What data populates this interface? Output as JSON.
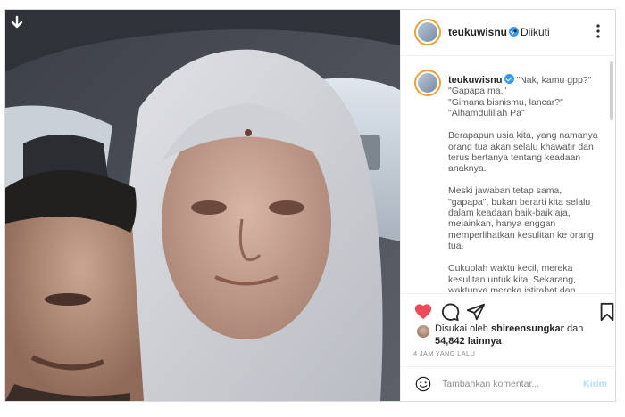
{
  "post": {
    "username": "teukuwisnu",
    "dot": "•",
    "follow_status": "Diikuti",
    "caption": {
      "lines": [
        "\"Nak, kamu gpp?\"",
        "\"Gapapa ma,\"",
        "\"Gimana bisnismu, lancar?\"",
        "\"Alhamdulillah Pa\""
      ],
      "paragraphs": [
        "Berapapun usia kita, yang namanya orang tua akan selalu khawatir dan terus bertanya tentang keadaan anaknya.",
        "Meski jawaban tetap sama, \"gapapa\", bukan berarti kita selalu dalam keadaan baik-baik aja, melainkan, hanya enggan memperlihatkan kesulitan ke orang tua.",
        "Cukuplah waktu kecil, mereka kesulitan untuk kita. Sekarang, waktunya mereka istirahat dan"
      ]
    },
    "likes": {
      "liked_by_prefix": "Disukai oleh",
      "liked_by_user": "shireensungkar",
      "and": "dan",
      "count": "54,842",
      "others": "lainnya"
    },
    "time": "4 JAM YANG LALU",
    "comment": {
      "placeholder": "Tambahkan komentar...",
      "send_label": "Kirim"
    }
  },
  "icons": {
    "download": "download-arrow-icon",
    "more": "more-dots-icon",
    "like": "heart-icon",
    "comment": "comment-bubble-icon",
    "share": "paper-plane-icon",
    "save": "bookmark-icon",
    "emoji": "smiley-icon"
  },
  "colors": {
    "like": "#ed4956",
    "verified": "#3897f0",
    "send_disabled": "#b2dffc",
    "avatar_ring": "#e8a23a"
  }
}
